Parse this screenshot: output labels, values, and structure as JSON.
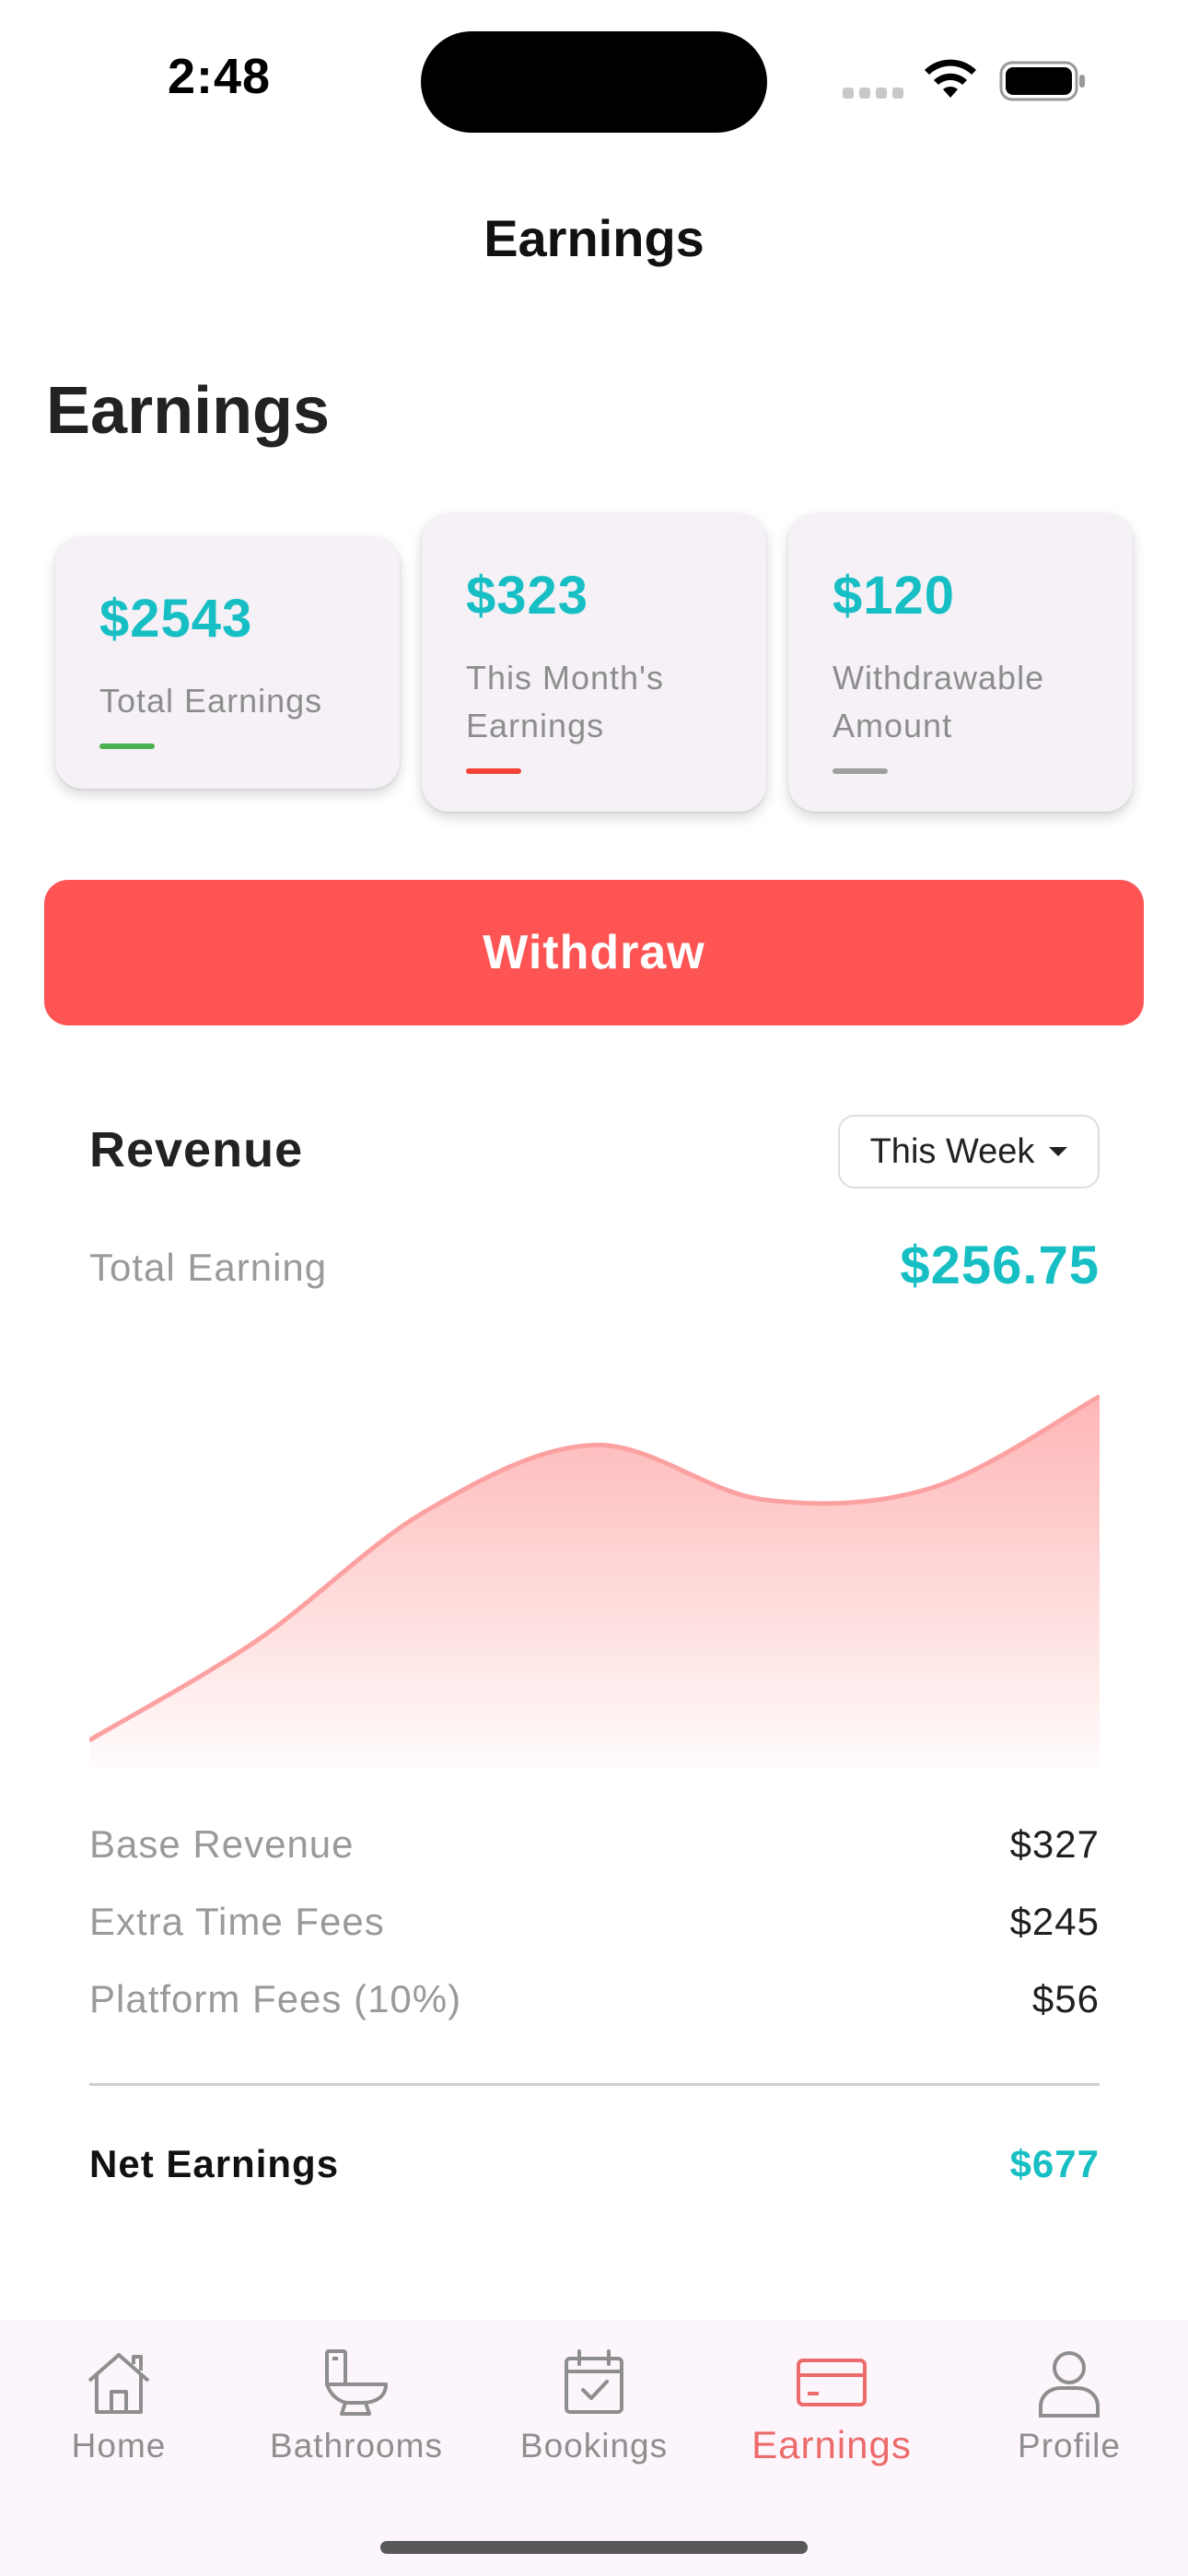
{
  "status_bar": {
    "time": "2:48"
  },
  "nav": {
    "title": "Earnings"
  },
  "section": {
    "title": "Earnings"
  },
  "cards": [
    {
      "amount": "$2543",
      "label": "Total Earnings",
      "accent": "#4caf50"
    },
    {
      "amount": "$323",
      "label": "This Month's Earnings",
      "accent": "#f44336"
    },
    {
      "amount": "$120",
      "label": "Withdrawable Amount",
      "accent": "#9e9e9e"
    }
  ],
  "withdraw_label": "Withdraw",
  "revenue": {
    "title": "Revenue",
    "period": "This Week",
    "total_label": "Total Earning",
    "total_value": "$256.75",
    "breakdown": [
      {
        "label": "Base Revenue",
        "value": "$327"
      },
      {
        "label": "Extra Time Fees",
        "value": "$245"
      },
      {
        "label": "Platform Fees (10%)",
        "value": "$56"
      }
    ],
    "net_label": "Net Earnings",
    "net_value": "$677"
  },
  "chart_data": {
    "type": "area",
    "x": [
      0,
      1,
      2,
      3,
      4,
      5,
      6
    ],
    "values": [
      10,
      45,
      90,
      113,
      94,
      98,
      130
    ],
    "ylim": [
      0,
      135
    ],
    "color": "#fe6b6b",
    "grid": false,
    "legend": "none"
  },
  "tabs": [
    {
      "label": "Home",
      "icon": "home-icon",
      "active": false
    },
    {
      "label": "Bathrooms",
      "icon": "toilet-icon",
      "active": false
    },
    {
      "label": "Bookings",
      "icon": "calendar-check-icon",
      "active": false
    },
    {
      "label": "Earnings",
      "icon": "credit-card-icon",
      "active": true
    },
    {
      "label": "Profile",
      "icon": "person-icon",
      "active": false
    }
  ],
  "colors": {
    "accent_teal": "#17bfc4",
    "accent_red": "#fe5454",
    "tab_active": "#ec6b6b"
  }
}
